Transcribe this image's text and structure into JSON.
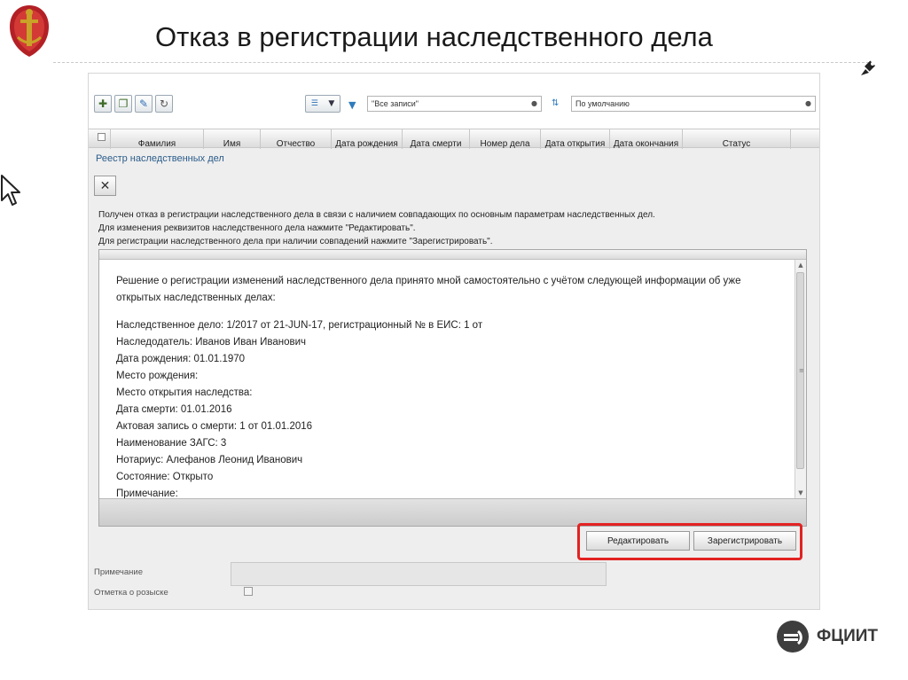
{
  "slide": {
    "title": "Отказ в регистрации наследственного дела"
  },
  "toolbar": {
    "filter_value": "\"Все записи\"",
    "sort_value": "По умолчанию"
  },
  "grid": {
    "columns": [
      "Фамилия",
      "Имя",
      "Отчество",
      "Дата рождения",
      "Дата смерти",
      "Номер дела",
      "Дата открытия",
      "Дата окончания",
      "Статус"
    ]
  },
  "section": {
    "title": "Реестр наследственных дел"
  },
  "messages": [
    "Получен отказ в регистрации наследственного дела в связи с наличием совпадающих по основным параметрам наследственных дел.",
    "Для изменения реквизитов наследственного дела нажмите \"Редактировать\".",
    "Для регистрации наследственного дела при наличии совпадений нажмите \"Зарегистрировать\"."
  ],
  "info": {
    "lines": [
      "Решение о регистрации изменений наследственного дела принято мной самостоятельно с учётом следующей информации об уже",
      "открытых наследственных делах:",
      "Наследственное дело: 1/2017 от 21-JUN-17, регистрационный № в ЕИС: 1 от",
      "Наследодатель: Иванов Иван Иванович",
      "Дата рождения: 01.01.1970",
      "Место рождения:",
      "Место открытия наследства:",
      "Дата смерти: 01.01.2016",
      "Актовая запись о смерти: 1 от 01.01.2016",
      "Наименование ЗАГС: 3",
      "Нотариус: Алефанов Леонид Иванович",
      "Состояние: Открыто",
      "Примечание:"
    ]
  },
  "actions": {
    "edit_label": "Редактировать",
    "register_label": "Зарегистрировать"
  },
  "form": {
    "note_label": "Примечание",
    "search_mark_label": "Отметка о розыске"
  },
  "brand": {
    "name": "ФЦИИТ"
  },
  "colors": {
    "highlight": "#e32222",
    "section_title": "#2b5c8a",
    "emblem_red": "#b32025",
    "emblem_gold": "#c9a227"
  },
  "icons": [
    "emblem",
    "add-icon",
    "add-copy-icon",
    "edit-pencil-icon",
    "refresh-icon",
    "filter-icon",
    "sort-icon",
    "close-icon",
    "pen-icon",
    "cursor-icon",
    "brand-logo"
  ]
}
